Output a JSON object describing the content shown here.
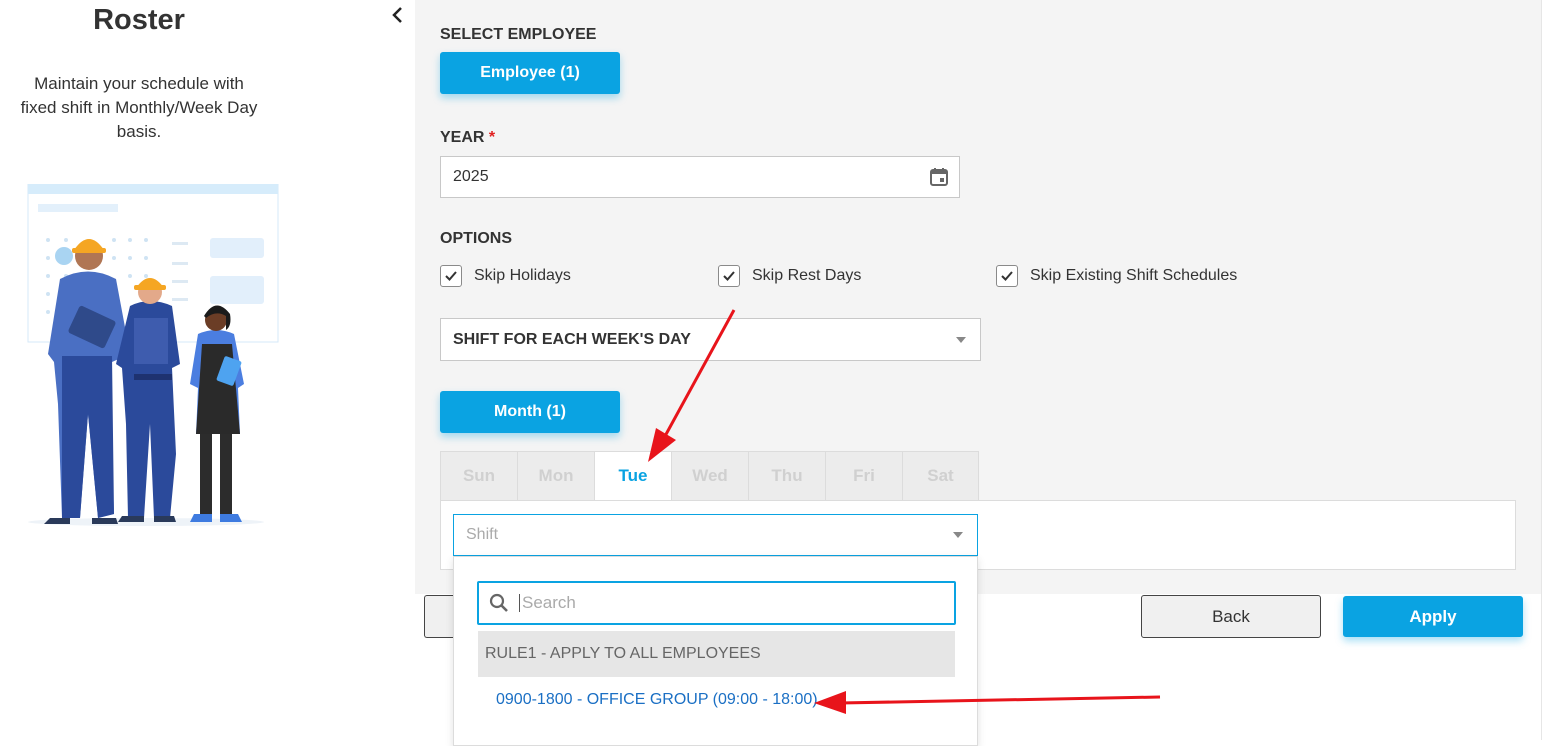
{
  "left_panel": {
    "title": "Roster",
    "description": "Maintain your schedule with fixed shift in Monthly/Week Day basis."
  },
  "form": {
    "select_employee_label": "SELECT EMPLOYEE",
    "employee_button": "Employee (1)",
    "year_label": "YEAR",
    "year_required_mark": "*",
    "year_value": "2025",
    "options_label": "OPTIONS",
    "options": [
      {
        "label": "Skip Holidays",
        "checked": true
      },
      {
        "label": "Skip Rest Days",
        "checked": true
      },
      {
        "label": "Skip Existing Shift Schedules",
        "checked": true
      }
    ],
    "shift_mode_select": "SHIFT FOR EACH WEEK'S DAY",
    "month_button": "Month (1)",
    "weekday_tabs": [
      "Sun",
      "Mon",
      "Tue",
      "Wed",
      "Thu",
      "Fri",
      "Sat"
    ],
    "active_tab": "Tue",
    "shift_placeholder": "Shift"
  },
  "dropdown": {
    "search_placeholder": "Search",
    "group_label": "RULE1 - APPLY TO ALL EMPLOYEES",
    "options": [
      "0900-1800 - OFFICE GROUP (09:00 - 18:00)"
    ]
  },
  "footer": {
    "back_button": "Back",
    "apply_button": "Apply"
  },
  "colors": {
    "accent": "#0aa3e2",
    "annotation_arrow": "#e8141b",
    "link": "#1a6fc4"
  }
}
